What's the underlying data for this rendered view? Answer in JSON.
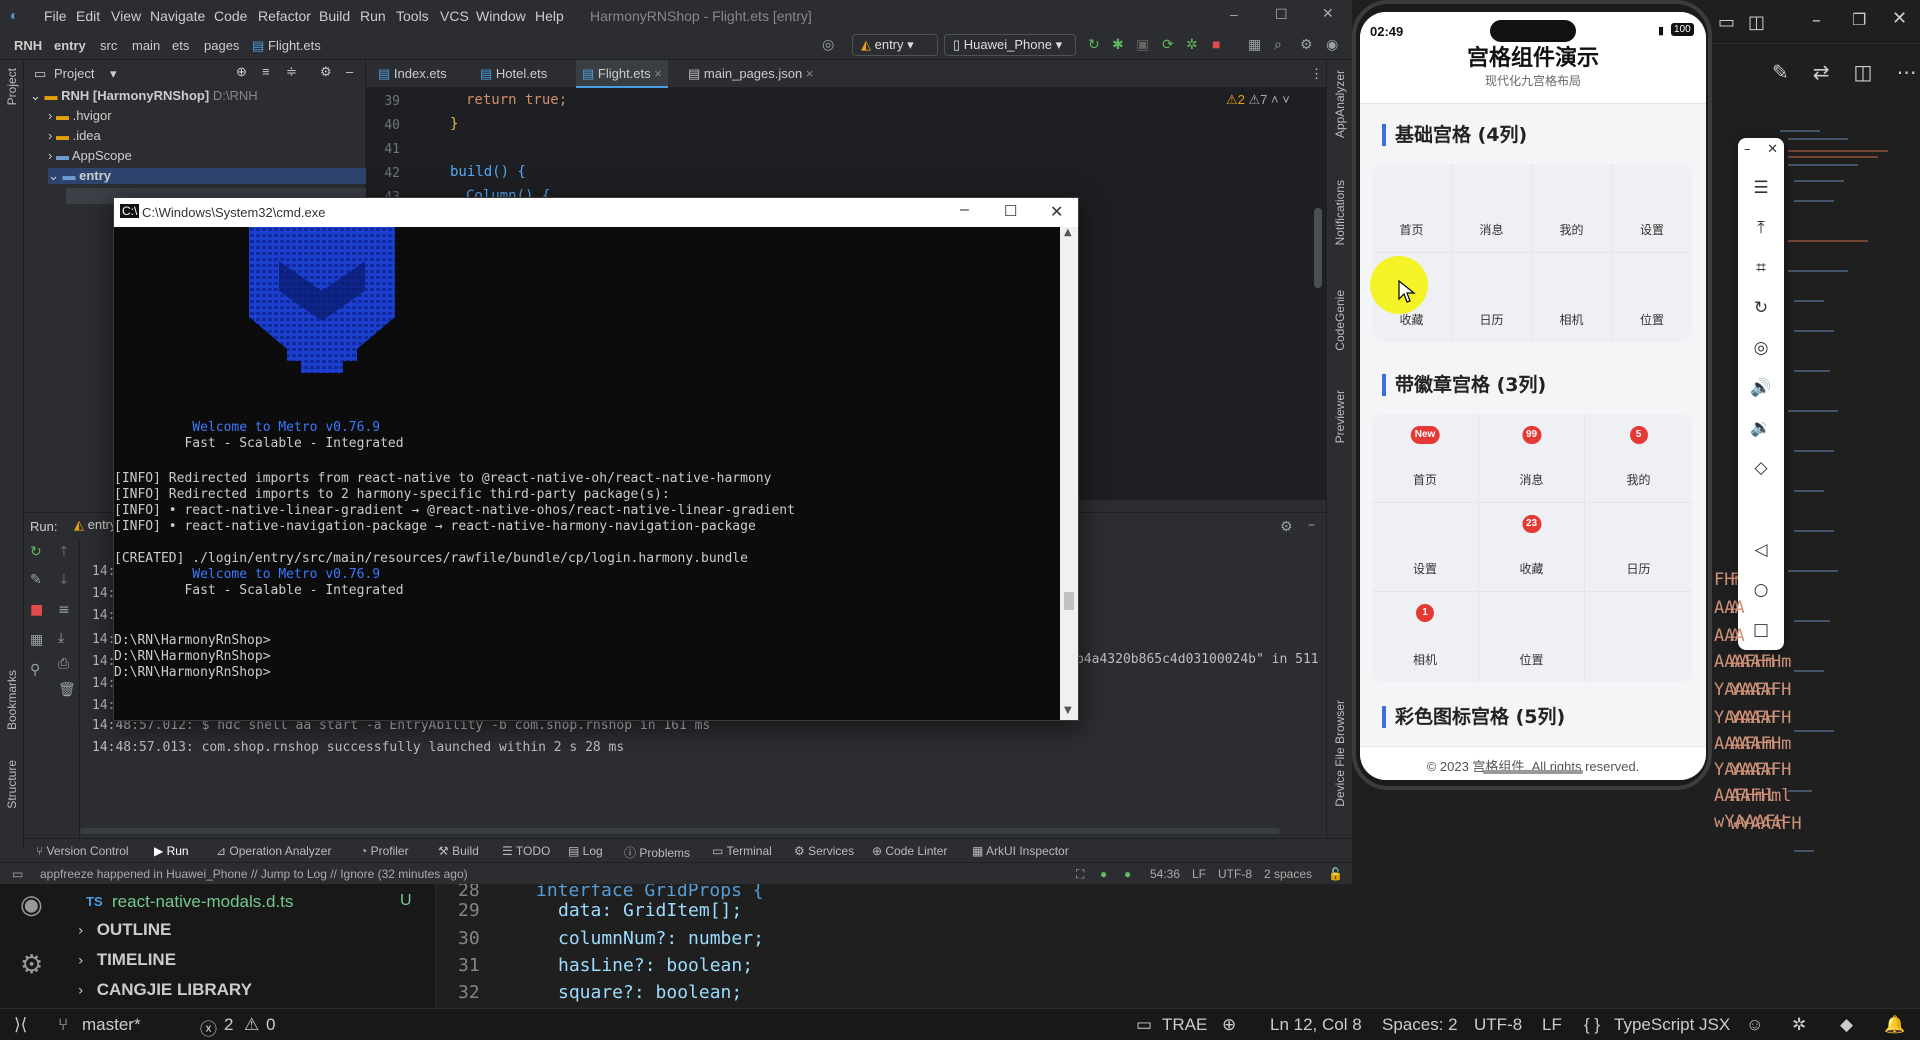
{
  "vscode": {
    "ansi_lines": [
      "FHm",
      "AAA",
      "AAA",
      "AAAFHm",
      "YAAAFH",
      "YAAAFH",
      "AAAFHm",
      "YAAAFH",
      "AAFHml",
      "wYAAAFH"
    ],
    "sidebar": {
      "file_lang": "TS",
      "file_name": "react-native-modals.d.ts",
      "file_status": "U",
      "sections": [
        "OUTLINE",
        "TIMELINE",
        "CANGJIE LIBRARY"
      ]
    },
    "code": {
      "lines": [
        {
          "no": "28",
          "text": "interface GridProps {"
        },
        {
          "no": "29",
          "text": "data: GridItem[];"
        },
        {
          "no": "30",
          "text": "columnNum?: number;"
        },
        {
          "no": "31",
          "text": "hasLine?: boolean;"
        },
        {
          "no": "32",
          "text": "square?: boolean;"
        }
      ]
    },
    "status": {
      "branch": "master*",
      "errors": "2",
      "warnings": "0",
      "trae": "TRAE",
      "cursor": "Ln 12, Col 8",
      "spaces": "Spaces: 2",
      "encoding": "UTF-8",
      "eol": "LF",
      "language": "TypeScript JSX"
    }
  },
  "ide": {
    "menu": [
      "File",
      "Edit",
      "View",
      "Navigate",
      "Code",
      "Refactor",
      "Build",
      "Run",
      "Tools",
      "VCS",
      "Window",
      "Help"
    ],
    "title": "HarmonyRNShop - Flight.ets [entry]",
    "breadcrumb": [
      "RNH",
      "entry",
      "src",
      "main",
      "ets",
      "pages",
      "Flight.ets"
    ],
    "run_config": "entry",
    "device": "Huawei_Phone",
    "project_label": "Project",
    "tree": [
      {
        "label": "RNH [HarmonyRNShop]",
        "path": "D:\\RNH"
      },
      {
        "label": ".hvigor"
      },
      {
        "label": ".idea"
      },
      {
        "label": "AppScope"
      },
      {
        "label": "entry"
      }
    ],
    "tabs": [
      "Index.ets",
      "Hotel.ets",
      "Flight.ets",
      "main_pages.json"
    ],
    "active_tab": "Flight.ets",
    "inspection": {
      "warnings": "2",
      "weak": "7"
    },
    "editor_lines": [
      {
        "no": "39",
        "text": "return true;"
      },
      {
        "no": "40",
        "text": "}"
      },
      {
        "no": "41",
        "text": ""
      },
      {
        "no": "42",
        "text": "build() {"
      },
      {
        "no": "43",
        "text": "Column() {"
      }
    ],
    "run_label": "Run:",
    "run_tab": "entry",
    "run_output": [
      "14:",
      "14:",
      "14:",
      "14:",
      "14:",
      "14:",
      "14:",
      "14:48:57.012: $ hdc shell aa start -a EntryAbility -b com.shop.rnshop in 161 ms",
      "14:48:57.013: com.shop.rnshop successfully launched within 2 s 28 ms"
    ],
    "run_overflow": "b4a4320b865c4d03100024b\" in 511",
    "left_strip": [
      "Project",
      "Bookmarks",
      "Structure"
    ],
    "right_strip": [
      "AppAnalyzer",
      "Notifications",
      "CodeGenie",
      "Previewer",
      "Device File Browser"
    ],
    "tool_tabs": [
      "Version Control",
      "Run",
      "Operation Analyzer",
      "Profiler",
      "Build",
      "TODO",
      "Log",
      "Problems",
      "Terminal",
      "Services",
      "Code Linter",
      "ArkUI Inspector"
    ],
    "status_message": "appfreeze happened in Huawei_Phone // Jump to Log // Ignore (32 minutes ago)",
    "status_right": {
      "position": "54:36",
      "eol": "LF",
      "encoding": "UTF-8",
      "indent": "2 spaces"
    }
  },
  "cmd": {
    "title": "C:\\Windows\\System32\\cmd.exe",
    "lines": [
      {
        "t": "          Welcome to Metro v0.76.9",
        "c": "blue-mix"
      },
      {
        "t": "         Fast - Scalable - Integrated",
        "c": "plain"
      },
      {
        "t": "",
        "c": "plain"
      },
      {
        "t": "",
        "c": "plain"
      },
      {
        "t": "[INFO] Redirected imports from react-native to @react-native-oh/react-native-harmony",
        "c": "plain"
      },
      {
        "t": "[INFO] Redirected imports to 2 harmony-specific third-party package(s):",
        "c": "plain"
      },
      {
        "t": "[INFO] • react-native-linear-gradient → @react-native-ohos/react-native-linear-gradient",
        "c": "plain"
      },
      {
        "t": "[INFO] • react-native-navigation-package → react-native-harmony-navigation-package",
        "c": "plain"
      },
      {
        "t": "",
        "c": "plain"
      },
      {
        "t": "[CREATED] ./login/entry/src/main/resources/rawfile/bundle/cp/login.harmony.bundle",
        "c": "plain"
      },
      {
        "t": "          Welcome to Metro v0.76.9",
        "c": "blue-mix"
      },
      {
        "t": "         Fast - Scalable - Integrated",
        "c": "plain"
      },
      {
        "t": "",
        "c": "plain"
      },
      {
        "t": "",
        "c": "plain"
      },
      {
        "t": "D:\\RN\\HarmonyRnShop>",
        "c": "plain"
      },
      {
        "t": "D:\\RN\\HarmonyRnShop>",
        "c": "plain"
      },
      {
        "t": "D:\\RN\\HarmonyRnShop>",
        "c": "plain"
      }
    ]
  },
  "phone": {
    "time": "02:49",
    "battery": "100",
    "title": "宫格组件演示",
    "subtitle": "现代化九宫格布局",
    "section1": {
      "title": "基础宫格 (4列)",
      "items": [
        "首页",
        "消息",
        "我的",
        "设置",
        "收藏",
        "日历",
        "相机",
        "位置"
      ]
    },
    "section2": {
      "title": "带徽章宫格 (3列)",
      "items": [
        {
          "label": "首页",
          "badge": "New"
        },
        {
          "label": "消息",
          "badge": "99"
        },
        {
          "label": "我的",
          "badge": "5"
        },
        {
          "label": "设置",
          "badge": ""
        },
        {
          "label": "收藏",
          "badge": "23"
        },
        {
          "label": "日历",
          "badge": ""
        },
        {
          "label": "相机",
          "badge": "1"
        },
        {
          "label": "位置",
          "badge": ""
        }
      ]
    },
    "section3": {
      "title": "彩色图标宫格 (5列)"
    },
    "footer": "© 2023 宫格组件. All rights reserved."
  },
  "colors": {
    "accent": "#3b6fd8",
    "badge": "#e53935",
    "cursor": "#f2f21a",
    "metro_blue": "#3b78ff"
  }
}
